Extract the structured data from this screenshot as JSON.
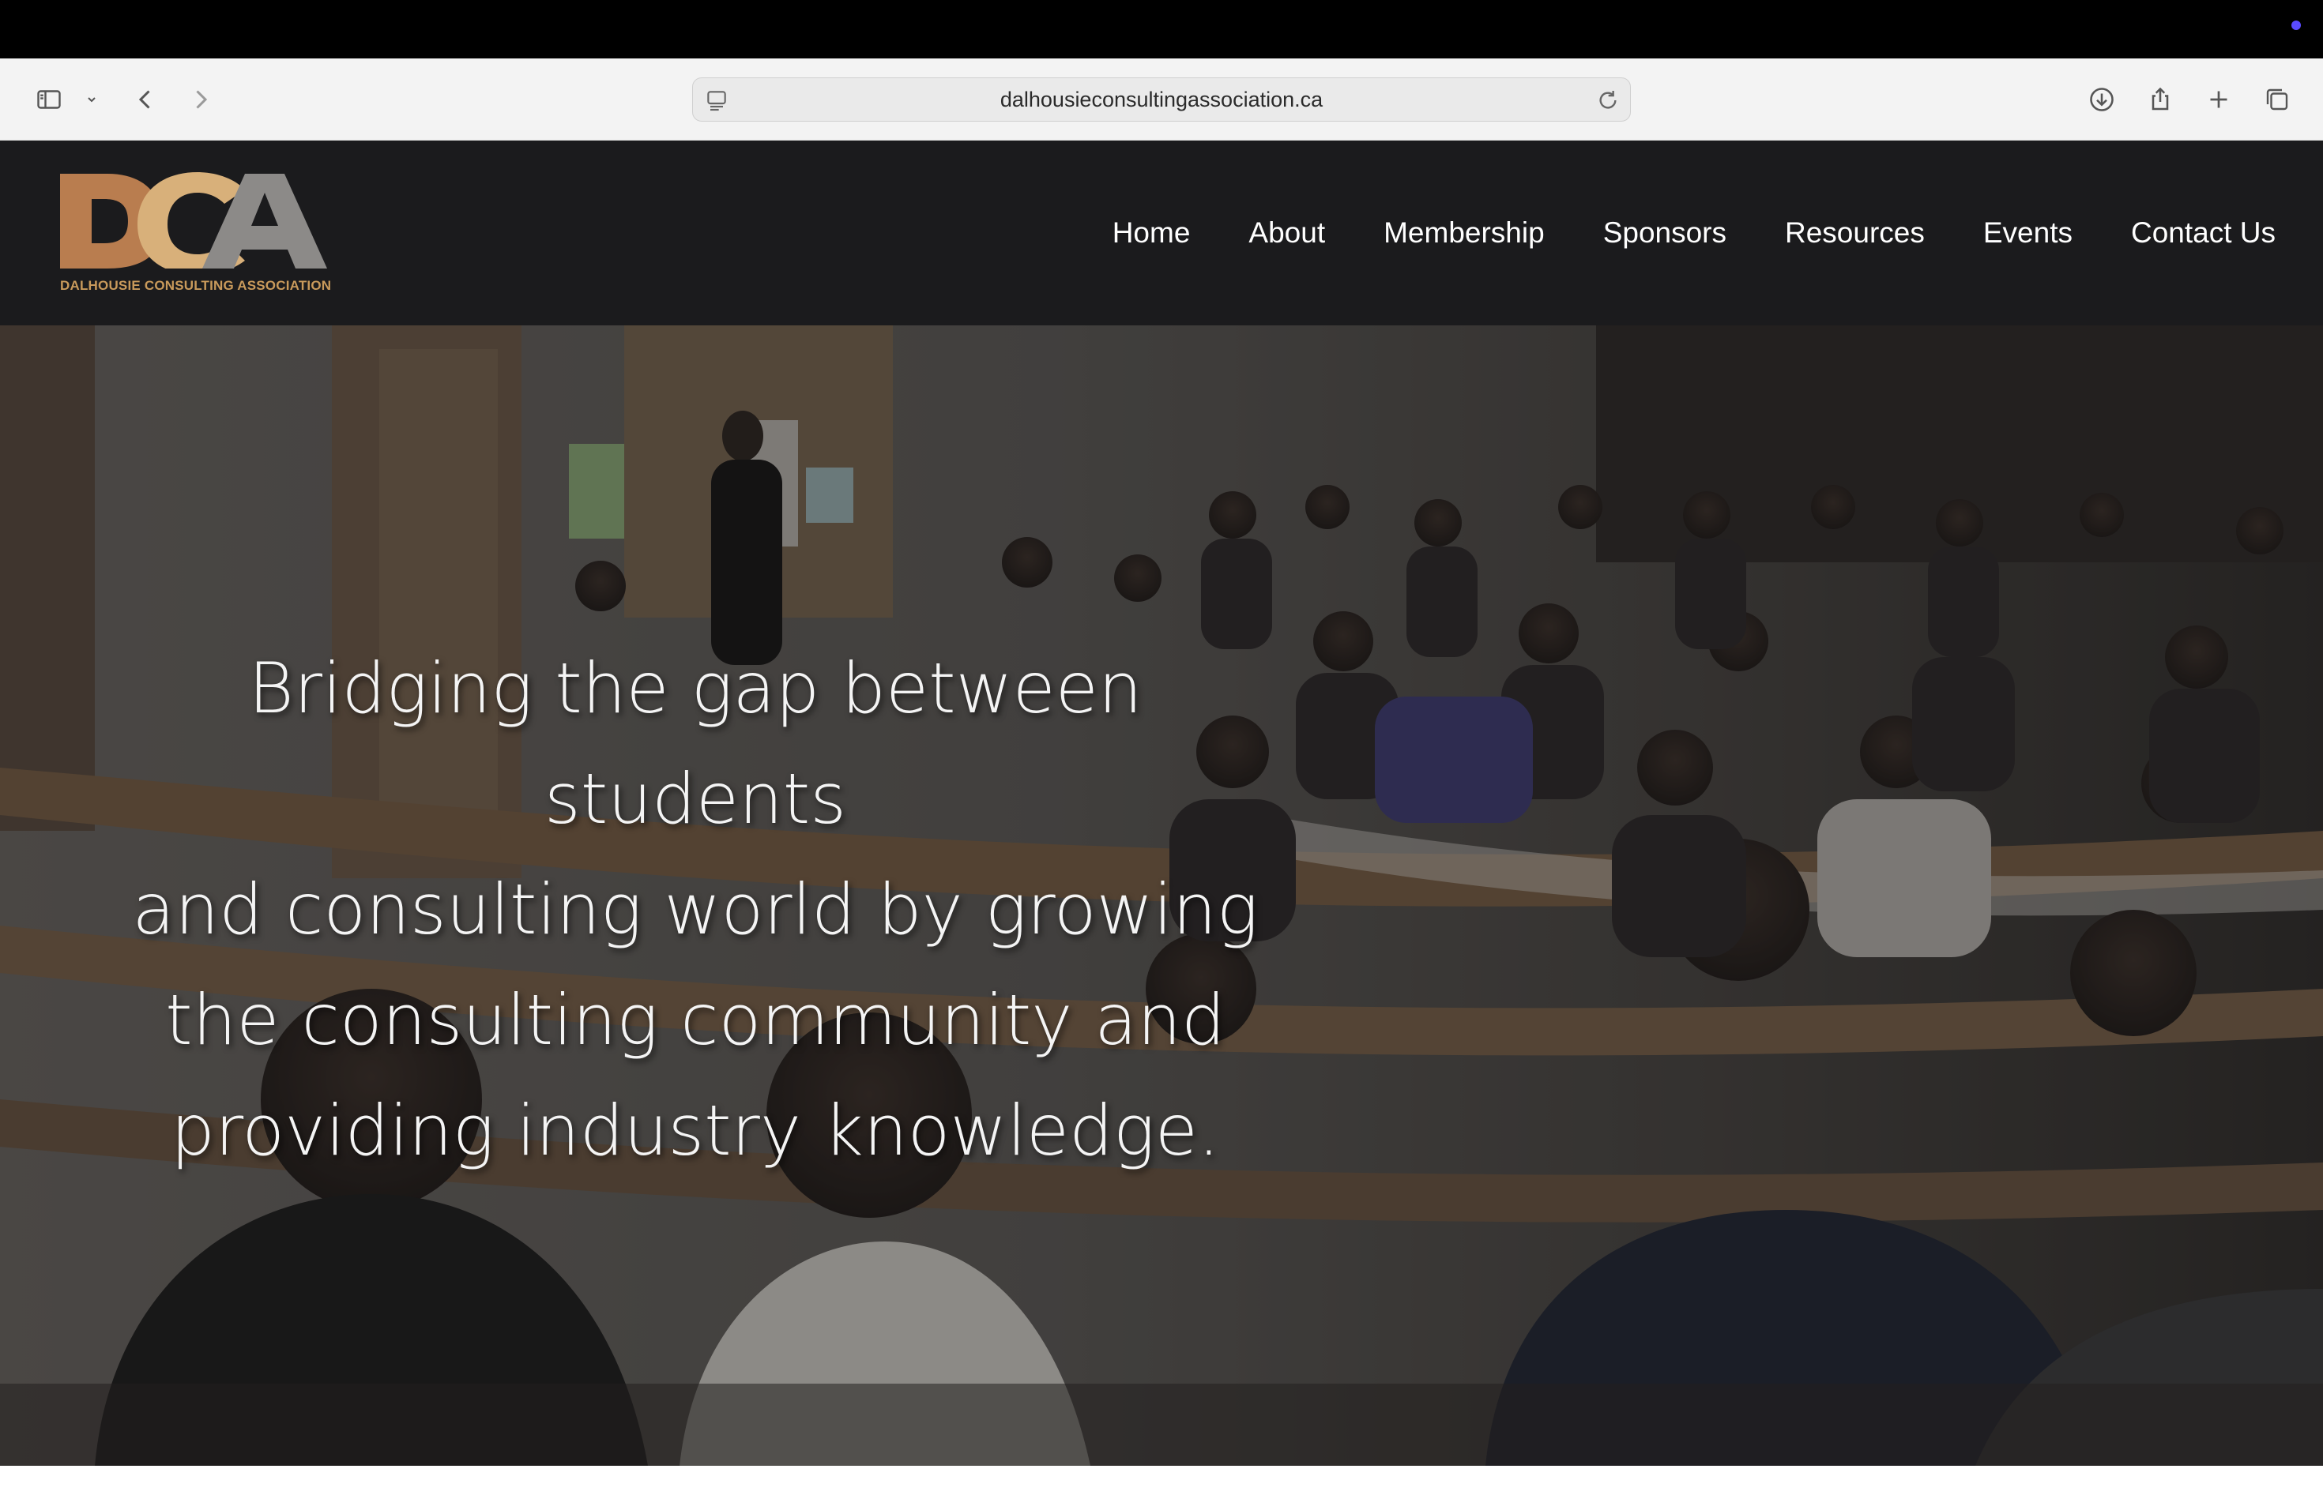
{
  "browser": {
    "url": "dalhousieconsultingassociation.ca",
    "icons": [
      "sidebar-icon",
      "chevron-down-icon",
      "back-icon",
      "forward-icon",
      "page-menu-icon",
      "reload-icon",
      "download-icon",
      "share-icon",
      "new-tab-icon",
      "tab-overview-icon"
    ]
  },
  "site": {
    "logo_text": "DCA",
    "logo_subtitle": "DALHOUSIE CONSULTING ASSOCIATION",
    "nav": [
      "Home",
      "About",
      "Membership",
      "Sponsors",
      "Resources",
      "Events",
      "Contact Us"
    ],
    "hero_lines": [
      "Bridging the gap between students",
      "and consulting world by growing",
      "the consulting community and",
      "providing industry knowledge."
    ]
  },
  "colors": {
    "header_bg": "#1b1b1d",
    "logo_d": "#b97d4f",
    "logo_c": "#d8b07a",
    "logo_a": "#8c8a88",
    "nav_text": "#ffffff"
  }
}
